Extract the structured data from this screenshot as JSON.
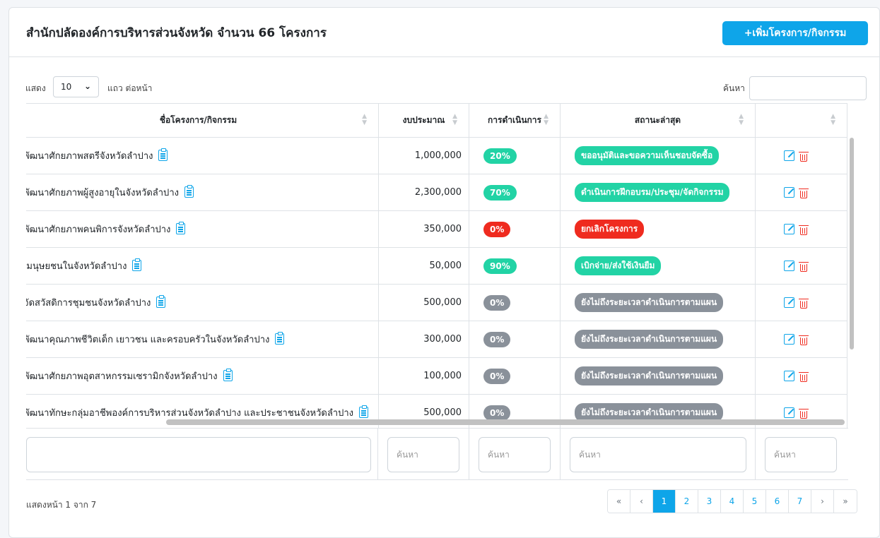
{
  "header": {
    "title": "สำนักปลัดองค์การบริหารส่วนจังหวัด จำนวน 66 โครงการ",
    "add_button": "+เพิ่มโครงการ/กิจกรรม"
  },
  "controls": {
    "show_label": "แสดง",
    "page_size": "10",
    "per_page_label": "แถว ต่อหน้า",
    "search_label": "ค้นหา",
    "search_value": ""
  },
  "table": {
    "columns": [
      "ชื่อโครงการ/กิจกรรม",
      "งบประมาณ",
      "การดำเนินการ",
      "สถานะล่าสุด",
      ""
    ],
    "rows": [
      {
        "name": "ะพัฒนาศักยภาพสตรีจังหวัดลำปาง",
        "budget": "1,000,000",
        "progress": "20%",
        "progress_color": "#22d3a5",
        "status": "ขออนุมัติและขอความเห็นชอบจัดซื้อ",
        "status_color": "#22d3a5"
      },
      {
        "name": "ะพัฒนาศักยภาพผู้สูงอายุในจังหวัดลำปาง",
        "budget": "2,300,000",
        "progress": "70%",
        "progress_color": "#22d3a5",
        "status": "ดำเนินการฝึกอบรม/ประชุม/จัดกิจกรรม",
        "status_color": "#22d3a5"
      },
      {
        "name": "ะพัฒนาศักยภาพคนพิการจังหวัดลำปาง",
        "budget": "350,000",
        "progress": "0%",
        "progress_color": "#ef2b1f",
        "status": "ยกเลิกโครงการ",
        "status_color": "#ef2b1f"
      },
      {
        "name": "เริมนุษยชนในจังหวัดลำปาง",
        "budget": "50,000",
        "progress": "90%",
        "progress_color": "#22d3a5",
        "status": "เบิกจ่าย/ส่งใช้เงินยืม",
        "status_color": "#22d3a5"
      },
      {
        "name": "รจัดสวัสดิการชุมชนจังหวัดลำปาง",
        "budget": "500,000",
        "progress": "0%",
        "progress_color": "#8a919a",
        "status": "ยังไม่ถึงระยะเวลาดำเนินการตามแผน",
        "status_color": "#8a919a"
      },
      {
        "name": "ะพัฒนาคุณภาพชีวิตเด็ก เยาวชน และครอบครัวในจังหวัดลำปาง",
        "budget": "300,000",
        "progress": "0%",
        "progress_color": "#8a919a",
        "status": "ยังไม่ถึงระยะเวลาดำเนินการตามแผน",
        "status_color": "#8a919a"
      },
      {
        "name": "ะพัฒนาศักยภาพอุตสาหกรรมเซรามิกจังหวัดลำปาง",
        "budget": "100,000",
        "progress": "0%",
        "progress_color": "#8a919a",
        "status": "ยังไม่ถึงระยะเวลาดำเนินการตามแผน",
        "status_color": "#8a919a"
      },
      {
        "name": "ะพัฒนาทักษะกลุ่มอาชีพองค์การบริหารส่วนจังหวัดลำปาง และประชาชนจังหวัดลำปาง",
        "budget": "500,000",
        "progress": "0%",
        "progress_color": "#8a919a",
        "status": "ยังไม่ถึงระยะเวลาดำเนินการตามแผน",
        "status_color": "#8a919a"
      }
    ]
  },
  "filters": {
    "placeholder": "ค้นหา"
  },
  "footer": {
    "info": "แสดงหน้า 1 จาก 7",
    "pages": [
      "«",
      "‹",
      "1",
      "2",
      "3",
      "4",
      "5",
      "6",
      "7",
      "›",
      "»"
    ],
    "active_page": "1"
  },
  "colors": {
    "accent": "#0ea5e9",
    "success": "#22d3a5",
    "danger": "#ef2b1f",
    "muted": "#8a919a"
  }
}
